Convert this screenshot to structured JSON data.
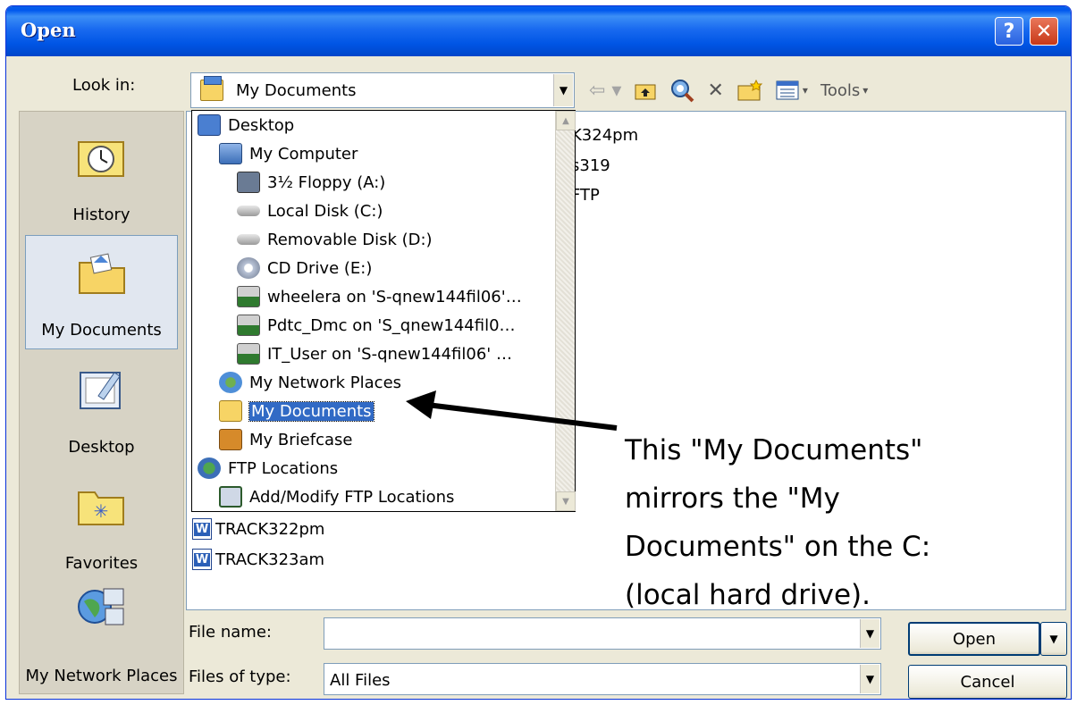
{
  "window": {
    "title": "Open",
    "help_glyph": "?",
    "close_glyph": "✕"
  },
  "lookin": {
    "label": "Look in:",
    "value": "My Documents"
  },
  "toolbar": {
    "tools_label": "Tools"
  },
  "places": [
    {
      "label": "History",
      "icon": "history-icon"
    },
    {
      "label": "My Documents",
      "icon": "my-documents-icon",
      "selected": true
    },
    {
      "label": "Desktop",
      "icon": "desktop-icon"
    },
    {
      "label": "Favorites",
      "icon": "favorites-icon"
    },
    {
      "label": "My Network Places",
      "icon": "network-places-icon"
    }
  ],
  "files_partial": [
    "K324pm",
    "s319",
    "FTP"
  ],
  "files": [
    "TRACK322pm",
    "TRACK323am"
  ],
  "dropdown": {
    "items": [
      {
        "label": "Desktop",
        "icon": "desktop-icon"
      },
      {
        "label": "My Computer",
        "icon": "computer-icon"
      },
      {
        "label": "3½ Floppy (A:)",
        "icon": "floppy-icon"
      },
      {
        "label": "Local Disk (C:)",
        "icon": "disk-icon"
      },
      {
        "label": "Removable Disk (D:)",
        "icon": "disk-icon"
      },
      {
        "label": "CD Drive (E:)",
        "icon": "cd-icon"
      },
      {
        "label": "wheelera on 'S-qnew144fil06'…",
        "icon": "network-drive-icon"
      },
      {
        "label": "Pdtc_Dmc on 'S_qnew144fil0…",
        "icon": "network-drive-icon"
      },
      {
        "label": "IT_User on 'S-qnew144fil06' …",
        "icon": "network-drive-icon"
      },
      {
        "label": "My Network Places",
        "icon": "network-places-icon"
      },
      {
        "label": "My Documents",
        "icon": "my-documents-icon",
        "selected": true
      },
      {
        "label": "My Briefcase",
        "icon": "briefcase-icon"
      },
      {
        "label": "FTP Locations",
        "icon": "ftp-icon"
      },
      {
        "label": "Add/Modify FTP Locations",
        "icon": "ftp-add-icon"
      }
    ]
  },
  "annotation": {
    "lines": [
      "This \"My Documents\"",
      "mirrors the \"My",
      "Documents\" on the C:",
      "(local hard drive)."
    ]
  },
  "filename": {
    "label": "File name:",
    "value": ""
  },
  "filetype": {
    "label": "Files of type:",
    "value": "All Files"
  },
  "buttons": {
    "open": "Open",
    "cancel": "Cancel"
  },
  "colors": {
    "title_bar": "#0055e5",
    "selection": "#316ac5",
    "dialog_bg": "#ece9d8"
  }
}
